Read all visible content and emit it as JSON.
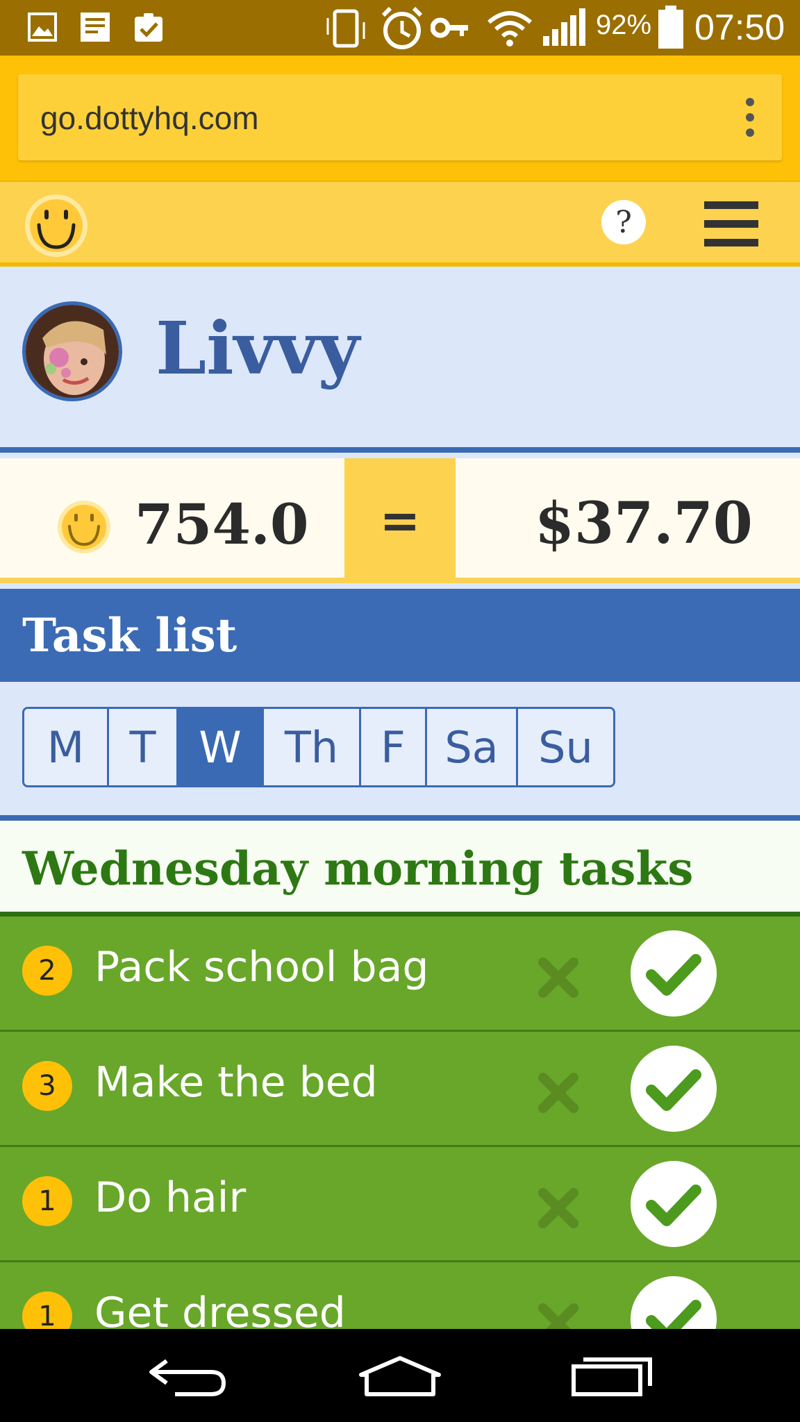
{
  "status_bar": {
    "battery_percent": "92%",
    "time": "07:50",
    "icons": [
      "gallery-icon",
      "notes-icon",
      "clipboard-icon",
      "vibrate-icon",
      "alarm-icon",
      "key-icon",
      "wifi-icon",
      "signal-icon",
      "battery-icon"
    ]
  },
  "browser": {
    "url": "go.dottyhq.com"
  },
  "header": {
    "help_label": "?"
  },
  "profile": {
    "name": "Livvy"
  },
  "points": {
    "value": "754.0",
    "equals": "=",
    "money": "$37.70"
  },
  "task_list": {
    "title": "Task list",
    "days": [
      {
        "label": "M",
        "active": false
      },
      {
        "label": "T",
        "active": false
      },
      {
        "label": "W",
        "active": true
      },
      {
        "label": "Th",
        "active": false
      },
      {
        "label": "F",
        "active": false
      },
      {
        "label": "Sa",
        "active": false
      },
      {
        "label": "Su",
        "active": false
      }
    ]
  },
  "section": {
    "title": "Wednesday morning tasks"
  },
  "tasks": [
    {
      "points": "2",
      "label": "Pack school bag"
    },
    {
      "points": "3",
      "label": "Make the bed"
    },
    {
      "points": "1",
      "label": "Do hair"
    },
    {
      "points": "1",
      "label": "Get dressed"
    }
  ],
  "colors": {
    "status_bar": "#9a6e00",
    "browser_bar": "#ffc107",
    "header_yellow": "#fdd24f",
    "primary_blue": "#3b6bb5",
    "task_green": "#68a72a",
    "section_green_text": "#2d7814"
  }
}
